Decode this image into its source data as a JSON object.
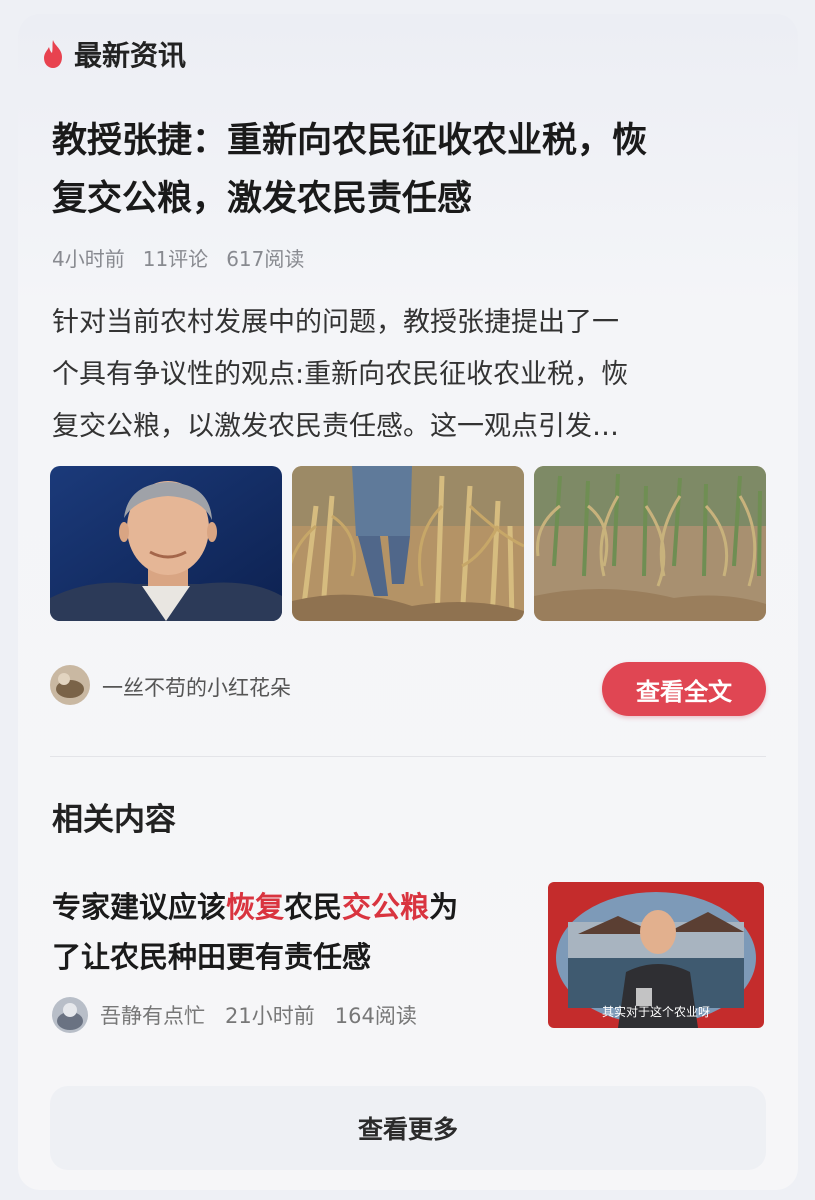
{
  "header": {
    "title": "最新资讯",
    "icon": "flame-icon",
    "icon_color": "#e8424f"
  },
  "article": {
    "headline_line1": "教授张捷：重新向农民征收农业税，恢",
    "headline_line2": "复交公粮，激发农民责任感",
    "meta": {
      "time": "4小时前",
      "comments": "11评论",
      "reads": "617阅读"
    },
    "summary_line1": "针对当前农村发展中的问题，教授张捷提出了一",
    "summary_line2": "个具有争议性的观点:重新向农民征收农业税，恢",
    "summary_line3": "复交公粮，以激发农民责任感。这一观点引发…",
    "images": [
      "portrait-photo",
      "cornfield-photo",
      "withered-corn-photo"
    ],
    "author": "一丝不苟的小红花朵",
    "read_full_label": "查看全文"
  },
  "related": {
    "section_title": "相关内容",
    "item": {
      "title_parts": [
        "专家建议应该",
        "恢复",
        "农民",
        "交公粮",
        "为"
      ],
      "title_line2": "了让农民种田更有责任感",
      "author": "吾静有点忙",
      "time": "21小时前",
      "reads": "164阅读",
      "caption": "其实对于这个农业呀"
    }
  },
  "more_label": "查看更多",
  "colors": {
    "accent": "#e04653",
    "highlight": "#d9343f",
    "background": "#eef0f5"
  }
}
